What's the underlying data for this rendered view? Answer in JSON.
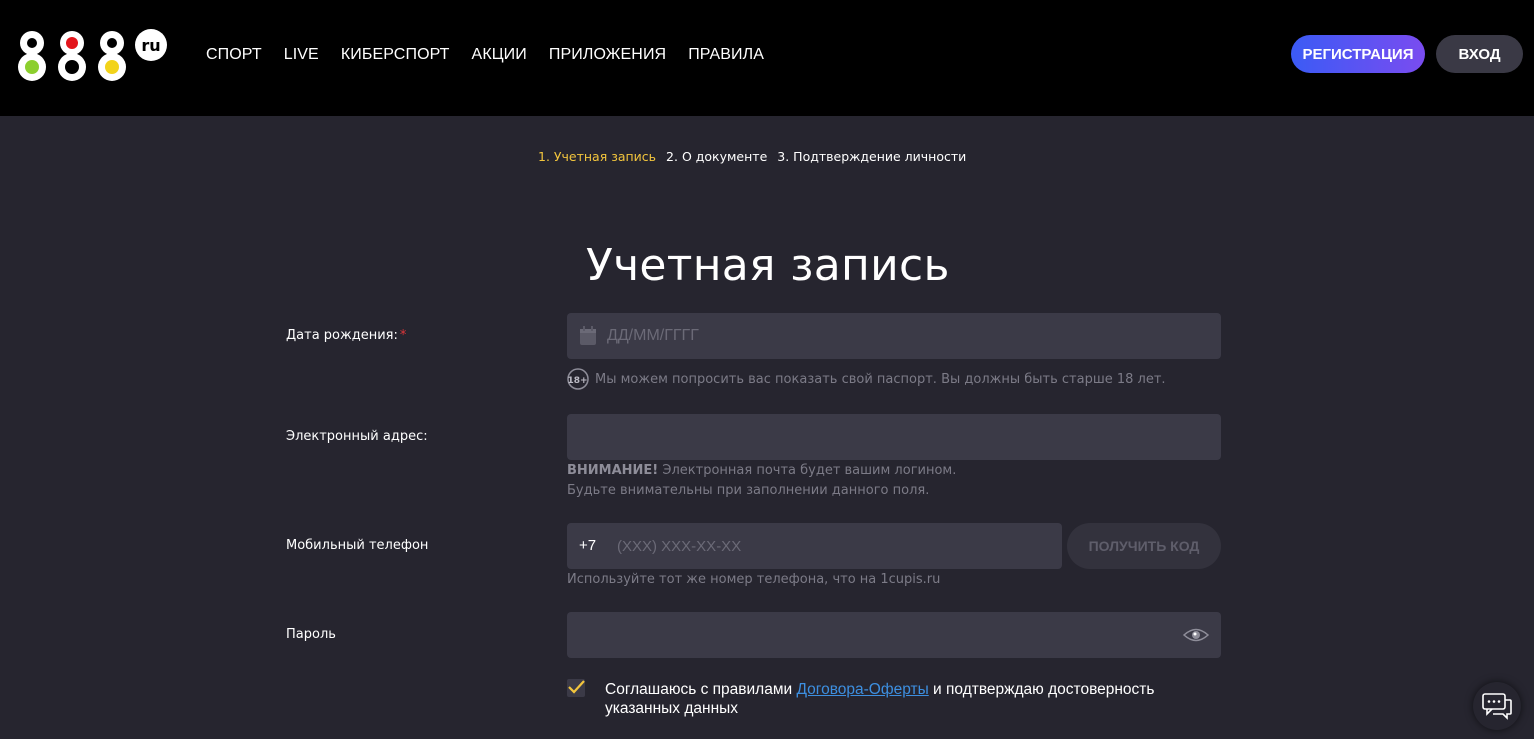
{
  "header": {
    "logo_text": "888",
    "logo_suffix": "ru",
    "nav": [
      "СПОРТ",
      "LIVE",
      "КИБЕРСПОРТ",
      "АКЦИИ",
      "ПРИЛОЖЕНИЯ",
      "ПРАВИЛА"
    ],
    "register_label": "РЕГИСТРАЦИЯ",
    "login_label": "ВХОД"
  },
  "steps": {
    "step1": "1. Учетная запись",
    "step2": "2. О документе",
    "step3": "3. Подтверждение личности"
  },
  "form": {
    "title": "Учетная запись",
    "birth": {
      "label": "Дата рождения:",
      "required_mark": "*",
      "placeholder": "ДД/ММ/ГГГГ",
      "hint": "Мы можем попросить вас показать свой паспорт. Вы должны быть старше 18 лет.",
      "age_badge": "18+"
    },
    "email": {
      "label": "Электронный адрес:",
      "placeholder": "",
      "warning_bold": "ВНИМАНИЕ!",
      "warning_text": " Электронная почта будет вашим логином.",
      "warning_line2": "Будьте внимательны при заполнении данного поля."
    },
    "phone": {
      "label": "Мобильный телефон",
      "prefix": "+7",
      "placeholder": "(XXX) XXX-XX-XX",
      "get_code_label": "ПОЛУЧИТЬ КОД",
      "hint": "Используйте тот же номер телефона, что на 1cupis.ru"
    },
    "password": {
      "label": "Пароль",
      "placeholder": ""
    },
    "agreement": {
      "checked": true,
      "text_before": "Соглашаюсь с правилами ",
      "link_text": "Договора-Оферты",
      "text_after": " и подтверждаю достоверность указанных данных"
    }
  },
  "colors": {
    "background": "#26252f",
    "header_bg": "#000000",
    "field_bg": "#3b3a47",
    "active_step": "#f2c53d",
    "link": "#3d8fe0",
    "required": "#e0363a"
  }
}
